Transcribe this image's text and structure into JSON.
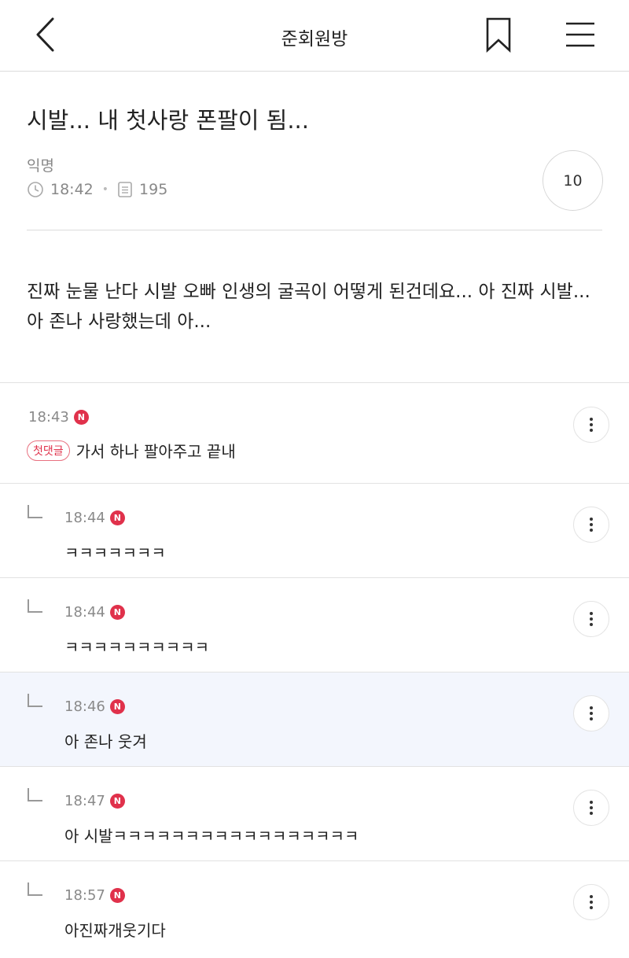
{
  "header": {
    "title": "준회원방"
  },
  "post": {
    "title": "시발... 내 첫사랑 폰팔이 됨...",
    "author": "익명",
    "time": "18:42",
    "views": "195",
    "comment_count": "10",
    "body": "진짜 눈물 난다 시발 오빠 인생의 굴곡이 어떻게 된건데요... 아 진짜 시발... 아 존나 사랑했는데 아..."
  },
  "comments": [
    {
      "time": "18:43",
      "badge": "N",
      "first_label": "첫댓글",
      "text": "가서 하나 팔아주고 끝내"
    },
    {
      "time": "18:44",
      "badge": "N",
      "text": "ㅋㅋㅋㅋㅋㅋㅋ"
    },
    {
      "time": "18:44",
      "badge": "N",
      "text": "ㅋㅋㅋㅋㅋㅋㅋㅋㅋㅋ"
    },
    {
      "time": "18:46",
      "badge": "N",
      "text": "아 존나 웃겨"
    },
    {
      "time": "18:47",
      "badge": "N",
      "text": "아 시발ㅋㅋㅋㅋㅋㅋㅋㅋㅋㅋㅋㅋㅋㅋㅋㅋㅋ"
    },
    {
      "time": "18:57",
      "badge": "N",
      "text": "아진짜개웃기다"
    }
  ],
  "colors": {
    "accent_red": "#e0314b",
    "highlight_bg": "#f3f6fd"
  }
}
